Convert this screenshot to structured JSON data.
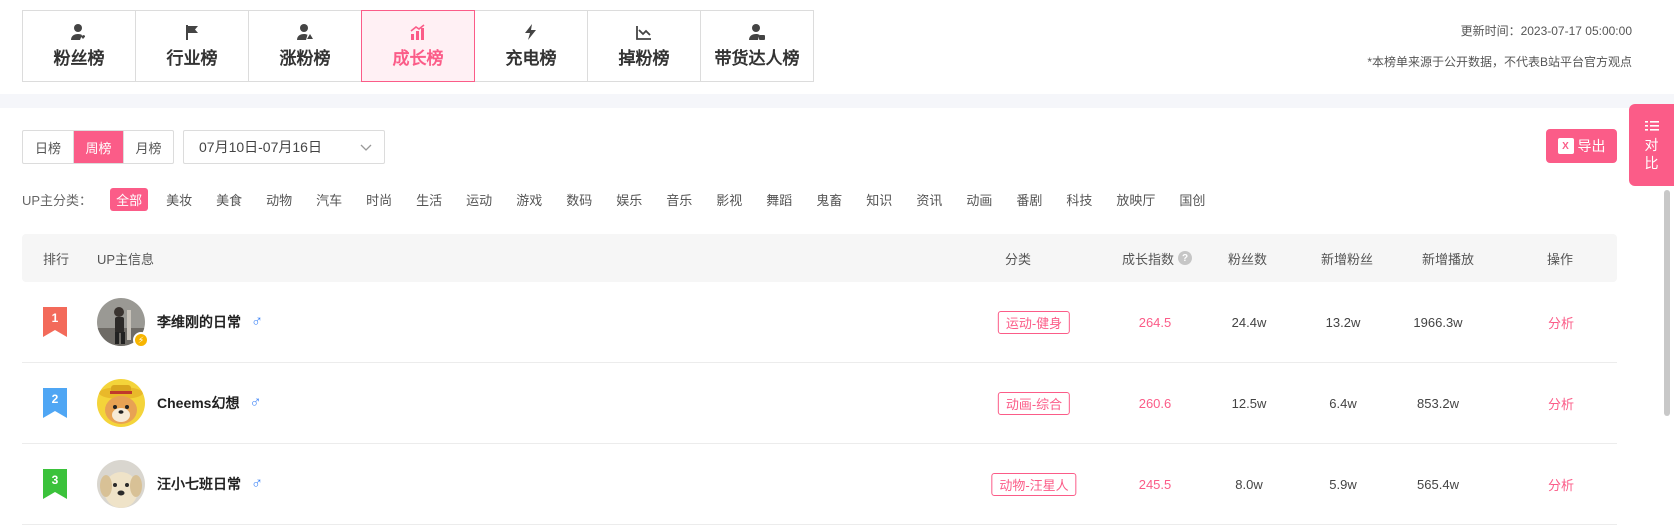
{
  "tabs": [
    {
      "label": "粉丝榜",
      "icon": "user-heart-icon"
    },
    {
      "label": "行业榜",
      "icon": "flag-icon"
    },
    {
      "label": "涨粉榜",
      "icon": "user-up-icon"
    },
    {
      "label": "成长榜",
      "icon": "bar-growth-icon",
      "active": true
    },
    {
      "label": "充电榜",
      "icon": "lightning-icon"
    },
    {
      "label": "掉粉榜",
      "icon": "chart-down-icon"
    },
    {
      "label": "带货达人榜",
      "icon": "user-shop-icon"
    }
  ],
  "meta": {
    "update_time": "更新时间：2023-07-17 05:00:00",
    "disclaimer": "*本榜单来源于公开数据，不代表B站平台官方观点"
  },
  "period": {
    "options": [
      "日榜",
      "周榜",
      "月榜"
    ],
    "selected": "周榜",
    "date_range": "07月10日-07月16日"
  },
  "actions": {
    "export_label": "导出",
    "compare_label": [
      "对",
      "比"
    ]
  },
  "categories": {
    "label": "UP主分类：",
    "items": [
      "全部",
      "美妆",
      "美食",
      "动物",
      "汽车",
      "时尚",
      "生活",
      "运动",
      "游戏",
      "数码",
      "娱乐",
      "音乐",
      "影视",
      "舞蹈",
      "鬼畜",
      "知识",
      "资讯",
      "动画",
      "番剧",
      "科技",
      "放映厅",
      "国创"
    ],
    "selected": "全部"
  },
  "table": {
    "headers": {
      "rank": "排行",
      "up_info": "UP主信息",
      "category": "分类",
      "growth_index": "成长指数",
      "fans": "粉丝数",
      "new_fans": "新增粉丝",
      "new_plays": "新增播放",
      "action": "操作"
    },
    "help_glyph": "?",
    "rows": [
      {
        "rank": "1",
        "rank_color": "#f36a5a",
        "name": "李维刚的日常",
        "gender": "♂",
        "verified": true,
        "category": "运动-健身",
        "growth": "264.5",
        "fans": "24.4w",
        "new_fans": "13.2w",
        "new_plays": "1966.3w",
        "action": "分析",
        "avatar": "man-photo-avatar"
      },
      {
        "rank": "2",
        "rank_color": "#4fa6f4",
        "name": "Cheems幻想",
        "gender": "♂",
        "verified": false,
        "category": "动画-综合",
        "growth": "260.6",
        "fans": "12.5w",
        "new_fans": "6.4w",
        "new_plays": "853.2w",
        "action": "分析",
        "avatar": "shiba-straw-hat-avatar"
      },
      {
        "rank": "3",
        "rank_color": "#3bc23b",
        "name": "汪小七班日常",
        "gender": "♂",
        "verified": false,
        "category": "动物-汪星人",
        "growth": "245.5",
        "fans": "8.0w",
        "new_fans": "5.9w",
        "new_plays": "565.4w",
        "action": "分析",
        "avatar": "golden-retriever-avatar"
      }
    ]
  }
}
